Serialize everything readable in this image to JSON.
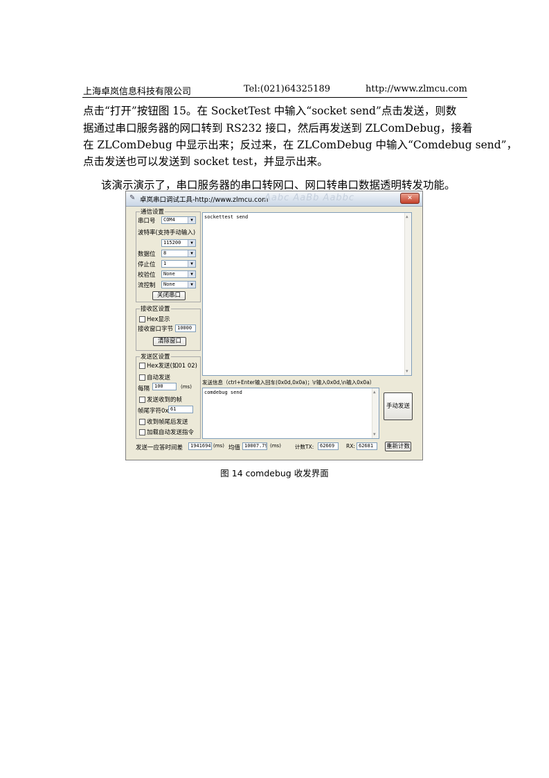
{
  "header": {
    "company": "上海卓岚信息科技有限公司",
    "tel": "Tel:(021)64325189",
    "url": "http://www.zlmcu.com"
  },
  "body": {
    "lines": [
      "点击“打开”按钮图 15。在 SocketTest 中输入“socket send”点击发送，则数",
      "据通过串口服务器的网口转到 RS232 接口，然后再发送到 ZLComDebug，接着",
      "在 ZLComDebug 中显示出来；反过来，在 ZLComDebug 中输入“Comdebug send”，",
      "点击发送也可以发送到 socket test，并显示出来。",
      "该演示演示了，串口服务器的串口转网口、网口转串口数据透明转发功能。"
    ]
  },
  "window": {
    "title": "卓岚串口调试工具-http://www.zlmcu.com",
    "title_watermark": "Aabc AaBb Aabbc",
    "comm": {
      "group_title": "通信设置",
      "port_label": "串口号",
      "port_value": "COM4",
      "baud_label": "波特率(支持手动输入)",
      "baud_value": "115200",
      "data_bits_label": "数据位",
      "data_bits_value": "8",
      "stop_bits_label": "停止位",
      "stop_bits_value": "1",
      "parity_label": "校验位",
      "parity_value": "None",
      "flow_label": "流控制",
      "flow_value": "None",
      "close_button": "关闭串口"
    },
    "recv": {
      "group_title": "接收区设置",
      "hex_label": "Hex显示",
      "bytes_label": "接收窗口字节",
      "bytes_value": "10000",
      "clear_button": "清除窗口"
    },
    "send": {
      "group_title": "发送区设置",
      "hex_label": "Hex发送(如01 02)",
      "auto_label": "自动发送",
      "interval_label": "每隔",
      "interval_value": "100",
      "interval_unit": "(ms)",
      "send_on_recv_label": "发送收到的帧",
      "tail_label": "帧尾字符0x",
      "tail_value": "61",
      "after_tail_label": "收到帧尾后发送",
      "auto_cmd_label": "加载自动发送指令"
    },
    "receive_text": "sockettest send",
    "send_info_label": "发送信息（ctrl+Enter输入回车(0x0d,0x0a)；\\r输入0x0d,\\n输入0x0a）",
    "send_text": "comdebug send",
    "manual_send_button": "手动发送",
    "status": {
      "delay_label": "发送一应答时间差",
      "delay_value": "19416948",
      "ms1": "(ms)",
      "avg_label": "均值",
      "avg_value": "10007.79",
      "ms2": "(ms)",
      "tx_label": "计数TX:",
      "tx_value": "62669",
      "rx_label": "RX:",
      "rx_value": "62681",
      "reset_button": "重新计数"
    }
  },
  "caption": "图 14 comdebug 收发界面"
}
